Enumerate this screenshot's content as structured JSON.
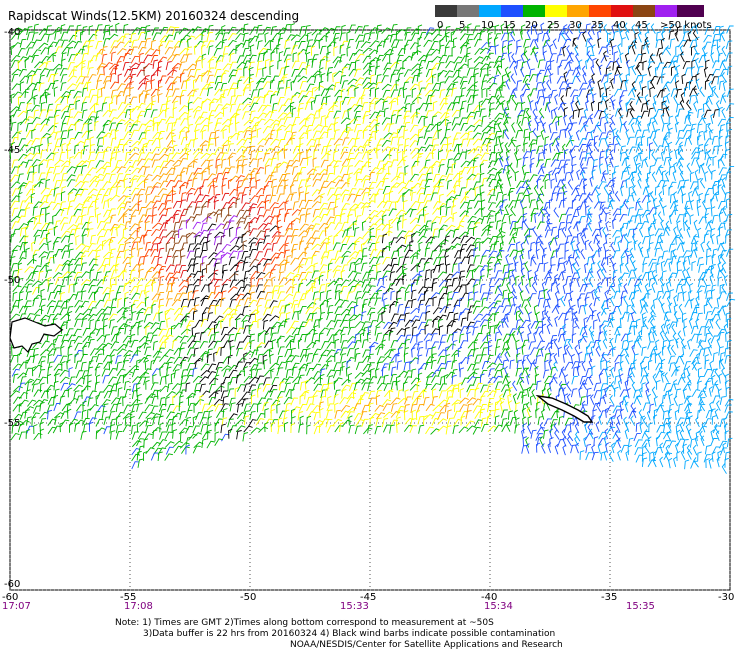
{
  "title": "Rapidscat Winds(12.5KM) 20160324 descending",
  "legend": {
    "colors": [
      "#3a3a3a",
      "#777777",
      "#00a8ff",
      "#1e50ff",
      "#00b400",
      "#ffff00",
      "#ffa500",
      "#ff4500",
      "#e01010",
      "#8b4513",
      "#a020f0",
      "#500050"
    ],
    "labels": [
      "0",
      "5",
      "10",
      "15",
      "20",
      "25",
      "30",
      "35",
      "40",
      "45",
      ">50 knots"
    ]
  },
  "lat_labels": [
    "-40",
    "-45",
    "-50",
    "-55",
    "-60"
  ],
  "lon_labels": [
    "-60",
    "-55",
    "-50",
    "-45",
    "-40",
    "-35",
    "-30"
  ],
  "time_labels": [
    "17:07",
    "17:08",
    "15:33",
    "15:34",
    "15:35"
  ],
  "notes": {
    "line1": "Note: 1) Times are GMT 2)Times along bottom correspond to measurement at ~50S",
    "line2": "3)Data buffer is 22 hrs from 20160324 4) Black wind barbs indicate possible contamination",
    "line3": "NOAA/NESDIS/Center for Satellite Applications and Research"
  }
}
